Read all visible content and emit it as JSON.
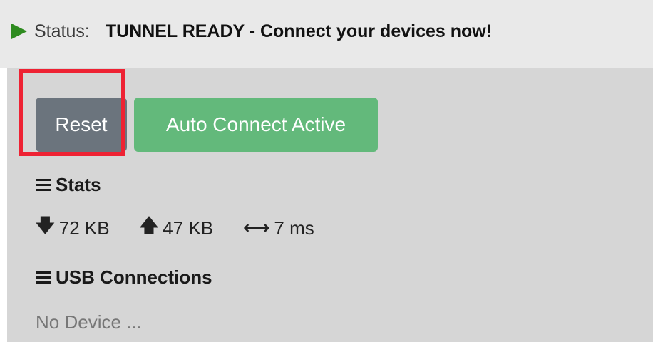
{
  "status": {
    "label": "Status:",
    "value": "TUNNEL READY - Connect your devices now!",
    "icon": "play-icon",
    "icon_color": "#2e8b1f"
  },
  "buttons": {
    "reset_label": "Reset",
    "auto_connect_label": "Auto Connect Active",
    "reset_color": "#6b747d",
    "auto_connect_color": "#63b97b"
  },
  "highlight_color": "#ee2233",
  "stats": {
    "title": "Stats",
    "download": {
      "icon": "arrow-down-icon",
      "value": "72 KB"
    },
    "upload": {
      "icon": "arrow-up-icon",
      "value": "47 KB"
    },
    "latency": {
      "icon": "arrow-left-right-icon",
      "value": "7 ms"
    }
  },
  "usb": {
    "title": "USB Connections",
    "empty_text": "No Device ..."
  }
}
